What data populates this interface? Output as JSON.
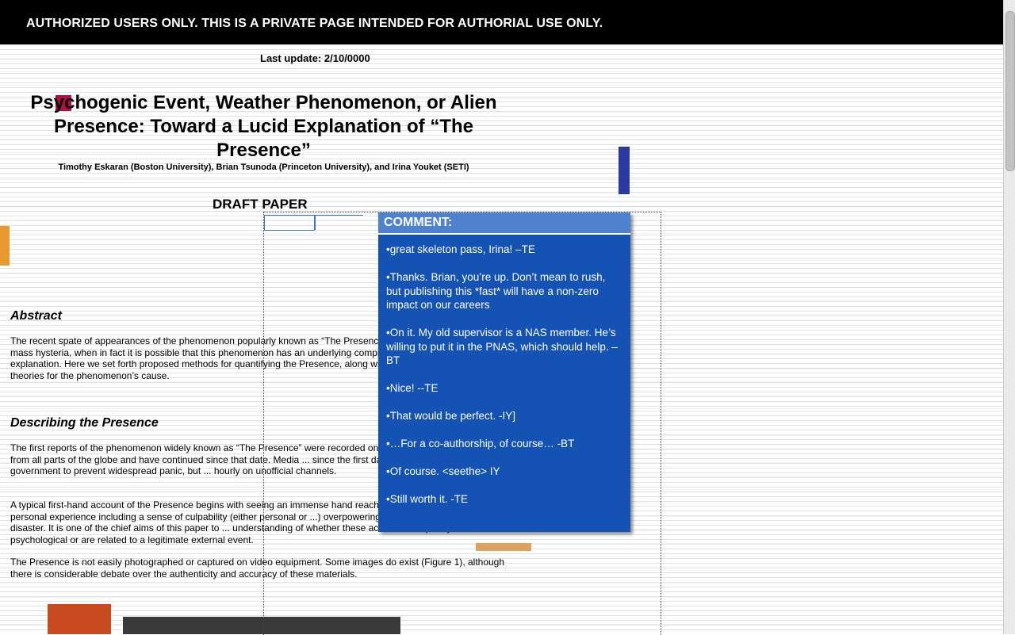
{
  "banner": {
    "text": "AUTHORIZED USERS ONLY. THIS IS A PRIVATE PAGE INTENDED FOR AUTHORIAL USE ONLY."
  },
  "last_update": "Last update: 2/10/0000",
  "paper": {
    "title": "Psychogenic Event, Weather Phenomenon, or Alien Presence: Toward a Lucid Explanation of “The Presence”",
    "authors": "Timothy Eskaran (Boston University), Brian Tsunoda (Princeton University), and Irina Youket (SETI)",
    "draft_label": "DRAFT PAPER",
    "abstract_heading": "Abstract",
    "abstract_text": "The recent spate of appearances of the phenomenon popularly known as “The Presence” has been dismissed as mass hysteria, when in fact it is possible that this phenomenon has an underlying comprehensible physical explanation. Here we set forth proposed methods for quantifying the Presence, along with a discussion of explanatory theories for the phenomenon’s cause.",
    "section_heading": "Describing the Presence",
    "section_p1": "The first reports of the phenomenon widely known as “The Presence” were recorded on ... The phenomenon came from all parts of the globe and have continued since that date. Media ... since the first day, possibly in an effort by the government to prevent widespread panic, but ... hourly on unofficial channels.",
    "section_p2": "A typical first-hand account of the Presence begins with seeing an immense hand reaching ... by an intensely personal experience including a sense of culpability (either personal or ...) overpowering sense of ongoing ecological disaster. It is one of the chief aims of this paper to ... understanding of whether these accounts are purely psychological or are related to a legitimate external event.",
    "section_p3": "The Presence is not easily photographed or captured on video equipment. Some images do exist (Figure 1), although there is considerable debate over the authenticity and accuracy of these materials."
  },
  "comment": {
    "header": "COMMENT:",
    "lines": [
      "•great skeleton pass, Irina! –TE",
      "•Thanks. Brian, you’re up. Don’t mean to rush, but publishing this *fast* will have a non-zero impact on our careers",
      "•On it. My old supervisor is a NAS member. He’s willing to put it in the PNAS, which should help. –BT",
      "•Nice! --TE",
      "•That would be perfect. -IY]",
      "•…For a co-authorship, of course… -BT",
      "•Of course. <seethe> IY",
      "•Still worth it. -TE"
    ]
  },
  "colors": {
    "comment_bg": "#1452b4",
    "comment_header": "#4e82d0",
    "banner_bg": "#000000"
  }
}
